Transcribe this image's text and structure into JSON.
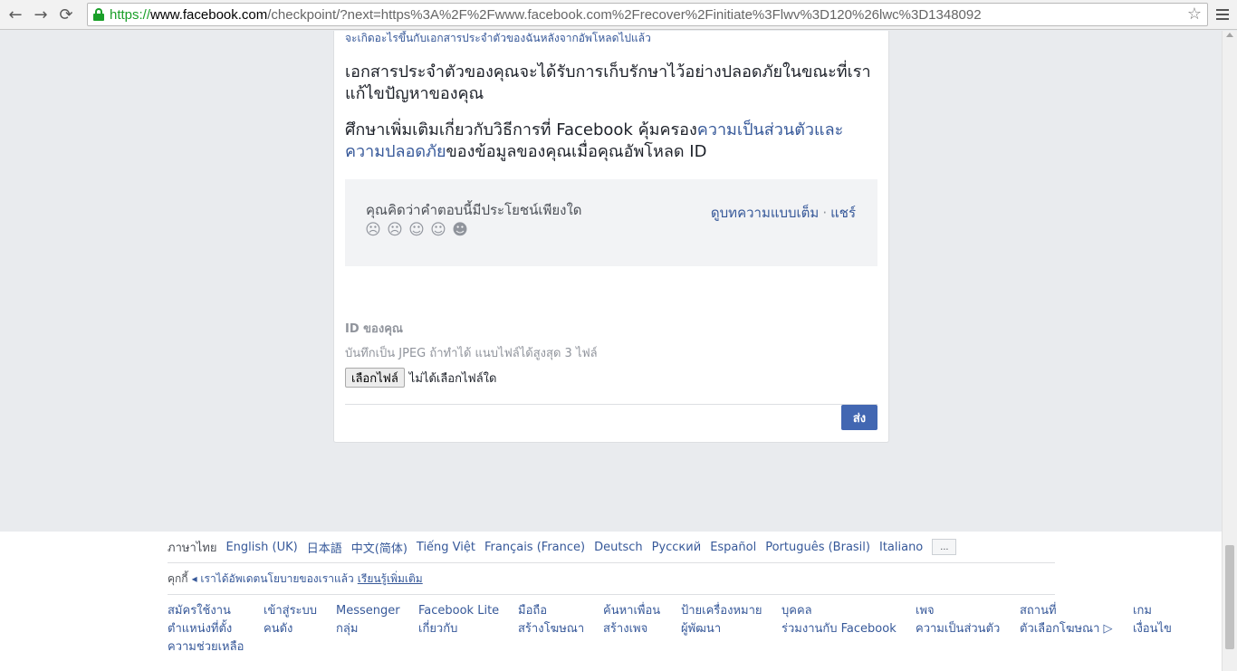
{
  "browser": {
    "url_scheme": "https://",
    "url_host": "www.facebook.com",
    "url_path": "/checkpoint/?next=https%3A%2F%2Fwww.facebook.com%2Frecover%2Finitiate%3Flwv%3D120%26lwc%3D1348092",
    "back_icon": "←",
    "forward_icon": "→",
    "reload_icon": "⟳",
    "star_icon": "☆"
  },
  "article": {
    "sub_link": "จะเกิดอะไรขึ้นกับเอกสารประจำตัวของฉันหลังจากอัพโหลดไปแล้ว",
    "para1": "เอกสารประจำตัวของคุณจะได้รับการเก็บรักษาไว้อย่างปลอดภัยในขณะที่เราแก้ไขปัญหาของคุณ",
    "para2_prefix": "ศึกษาเพิ่มเติมเกี่ยวกับวิธีการที่ Facebook คุ้มครอง",
    "para2_link": "ความเป็นส่วนตัวและความปลอดภัย",
    "para2_suffix": "ของข้อมูลของคุณเมื่อคุณอัพโหลด ID"
  },
  "feedback": {
    "question": "คุณคิดว่าคำตอบนี้มีประโยชน์เพียงใด",
    "faces": [
      "☹",
      "☹",
      "☺",
      "☺",
      "☻"
    ],
    "view_full": "ดูบทความแบบเต็ม",
    "separator": "·",
    "share": "แชร์"
  },
  "upload": {
    "title": "ID ของคุณ",
    "hint": "บันทึกเป็น JPEG ถ้าทำได้ แนบไฟล์ได้สูงสุด 3 ไฟล์",
    "choose_button": "เลือกไฟล์",
    "no_file": "ไม่ได้เลือกไฟล์ใด",
    "send_button": "ส่ง"
  },
  "footer": {
    "languages": [
      {
        "label": "ภาษาไทย",
        "current": true
      },
      {
        "label": "English (UK)",
        "current": false
      },
      {
        "label": "日本語",
        "current": false
      },
      {
        "label": "中文(简体)",
        "current": false
      },
      {
        "label": "Tiếng Việt",
        "current": false
      },
      {
        "label": "Français (France)",
        "current": false
      },
      {
        "label": "Deutsch",
        "current": false
      },
      {
        "label": "Русский",
        "current": false
      },
      {
        "label": "Español",
        "current": false
      },
      {
        "label": "Português (Brasil)",
        "current": false
      },
      {
        "label": "Italiano",
        "current": false
      }
    ],
    "more_languages": "...",
    "cookie_label": "คุกกี้",
    "cookie_notice": "◂ เราได้อัพเดตนโยบายของเราแล้ว",
    "learn_more": "เรียนรู้เพิ่มเติม",
    "link_columns": [
      [
        "สมัครใช้งาน",
        "ตำแหน่งที่ตั้ง",
        "ความช่วยเหลือ"
      ],
      [
        "เข้าสู่ระบบ",
        "คนดัง"
      ],
      [
        "Messenger",
        "กลุ่ม"
      ],
      [
        "Facebook Lite",
        "เกี่ยวกับ"
      ],
      [
        "มือถือ",
        "สร้างโฆษณา"
      ],
      [
        "ค้นหาเพื่อน",
        "สร้างเพจ"
      ],
      [
        "ป้ายเครื่องหมาย",
        "ผู้พัฒนา"
      ],
      [
        "บุคคล",
        "ร่วมงานกับ Facebook"
      ],
      [
        "เพจ",
        "ความเป็นส่วนตัว"
      ],
      [
        "สถานที่",
        "ตัวเลือกโฆษณา ▷"
      ],
      [
        "เกม",
        "เงื่อนไข"
      ]
    ]
  }
}
